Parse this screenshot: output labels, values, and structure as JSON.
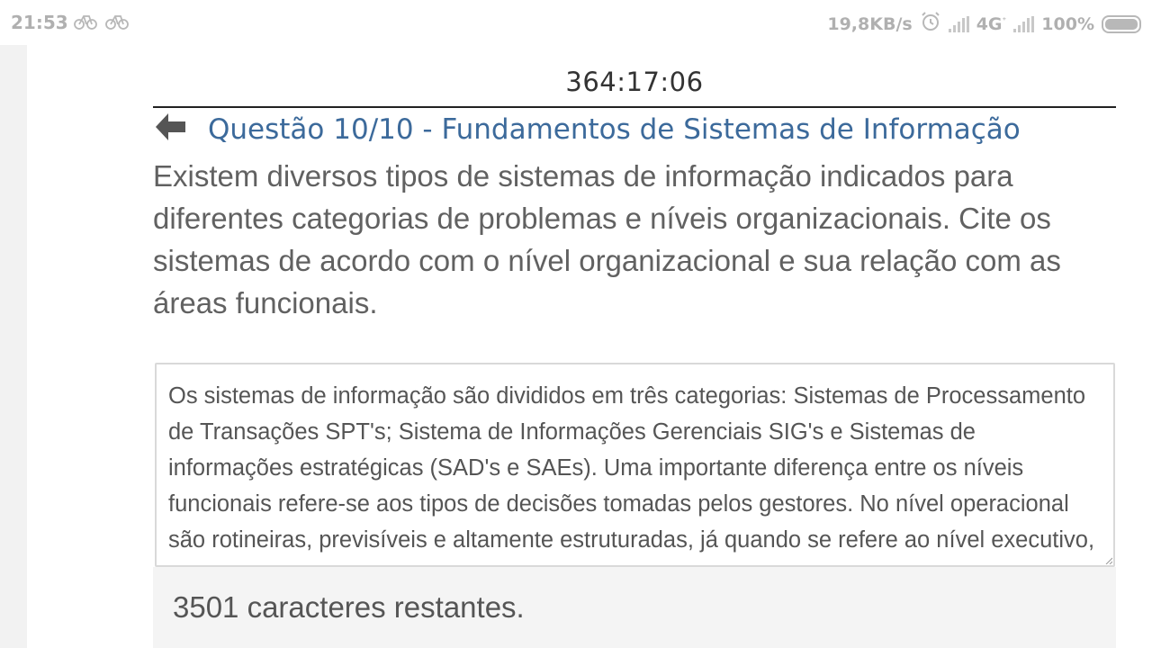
{
  "status_bar": {
    "time": "21:53",
    "notification_icons": [
      "bicycle-icon",
      "bicycle-icon"
    ],
    "network_speed": "19,8KB/s",
    "network_type": "4G",
    "battery_percent": "100%"
  },
  "timer": "364:17:06",
  "question": {
    "title": "Questão 10/10 - Fundamentos de Sistemas de Informação",
    "text": "Existem diversos tipos de sistemas de informação indicados para diferentes categorias de problemas e níveis organizacionais. Cite os sistemas de acordo com o nível organizacional e sua relação com as áreas funcionais."
  },
  "answer": {
    "value": "Os sistemas de informação são divididos em três categorias: Sistemas de Processamento de Transações SPT's; Sistema de Informações Gerenciais SIG's e Sistemas de informações estratégicas (SAD's e SAEs). Uma importante diferença entre os níveis funcionais refere-se aos tipos de decisões tomadas pelos gestores. No nível operacional são rotineiras, previsíveis e altamente estruturadas, já quando se refere ao nível executivo, elas são mais não-estruturadas"
  },
  "char_counter": "3501 caracteres restantes.",
  "colors": {
    "title_blue": "#3c6a9b",
    "body_text": "#616161",
    "status_grey": "#b0b0b0"
  }
}
